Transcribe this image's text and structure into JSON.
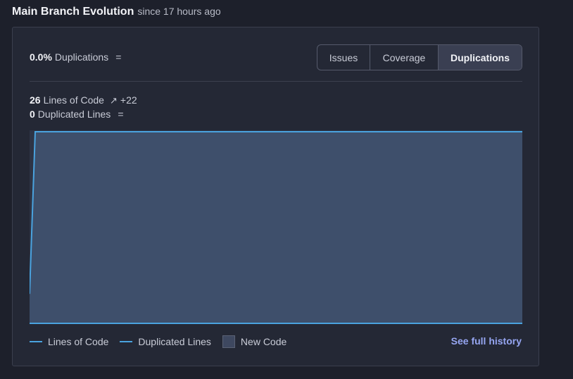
{
  "header": {
    "title": "Main Branch Evolution",
    "since": "since 17 hours ago"
  },
  "metric": {
    "value": "0.0%",
    "label": "Duplications",
    "trend": "="
  },
  "tabs": [
    {
      "label": "Issues",
      "selected": false
    },
    {
      "label": "Coverage",
      "selected": false
    },
    {
      "label": "Duplications",
      "selected": true
    }
  ],
  "stats": {
    "loc_value": "26",
    "loc_label": "Lines of Code",
    "loc_delta": "+22",
    "dup_value": "0",
    "dup_label": "Duplicated Lines",
    "dup_trend": "="
  },
  "chart_data": {
    "type": "area",
    "x": [
      0,
      1,
      2,
      3
    ],
    "series": [
      {
        "name": "Lines of Code",
        "values": [
          4,
          26,
          26,
          26
        ],
        "color": "#4aa3df"
      },
      {
        "name": "Duplicated Lines",
        "values": [
          0,
          0,
          0,
          0
        ],
        "color": "#4aa3df"
      }
    ],
    "new_code_period": true,
    "ylim": [
      0,
      26
    ],
    "grid": false
  },
  "legend": {
    "items": [
      {
        "label": "Lines of Code",
        "type": "line",
        "color": "#4aa3df"
      },
      {
        "label": "Duplicated Lines",
        "type": "line",
        "color": "#4aa3df"
      },
      {
        "label": "New Code",
        "type": "swatch",
        "color": "#3e4860"
      }
    ]
  },
  "links": {
    "history": "See full history"
  },
  "colors": {
    "accent": "#96a6f2",
    "background": "#1d202b",
    "card": "#242835",
    "area": "#3e4f6b"
  }
}
